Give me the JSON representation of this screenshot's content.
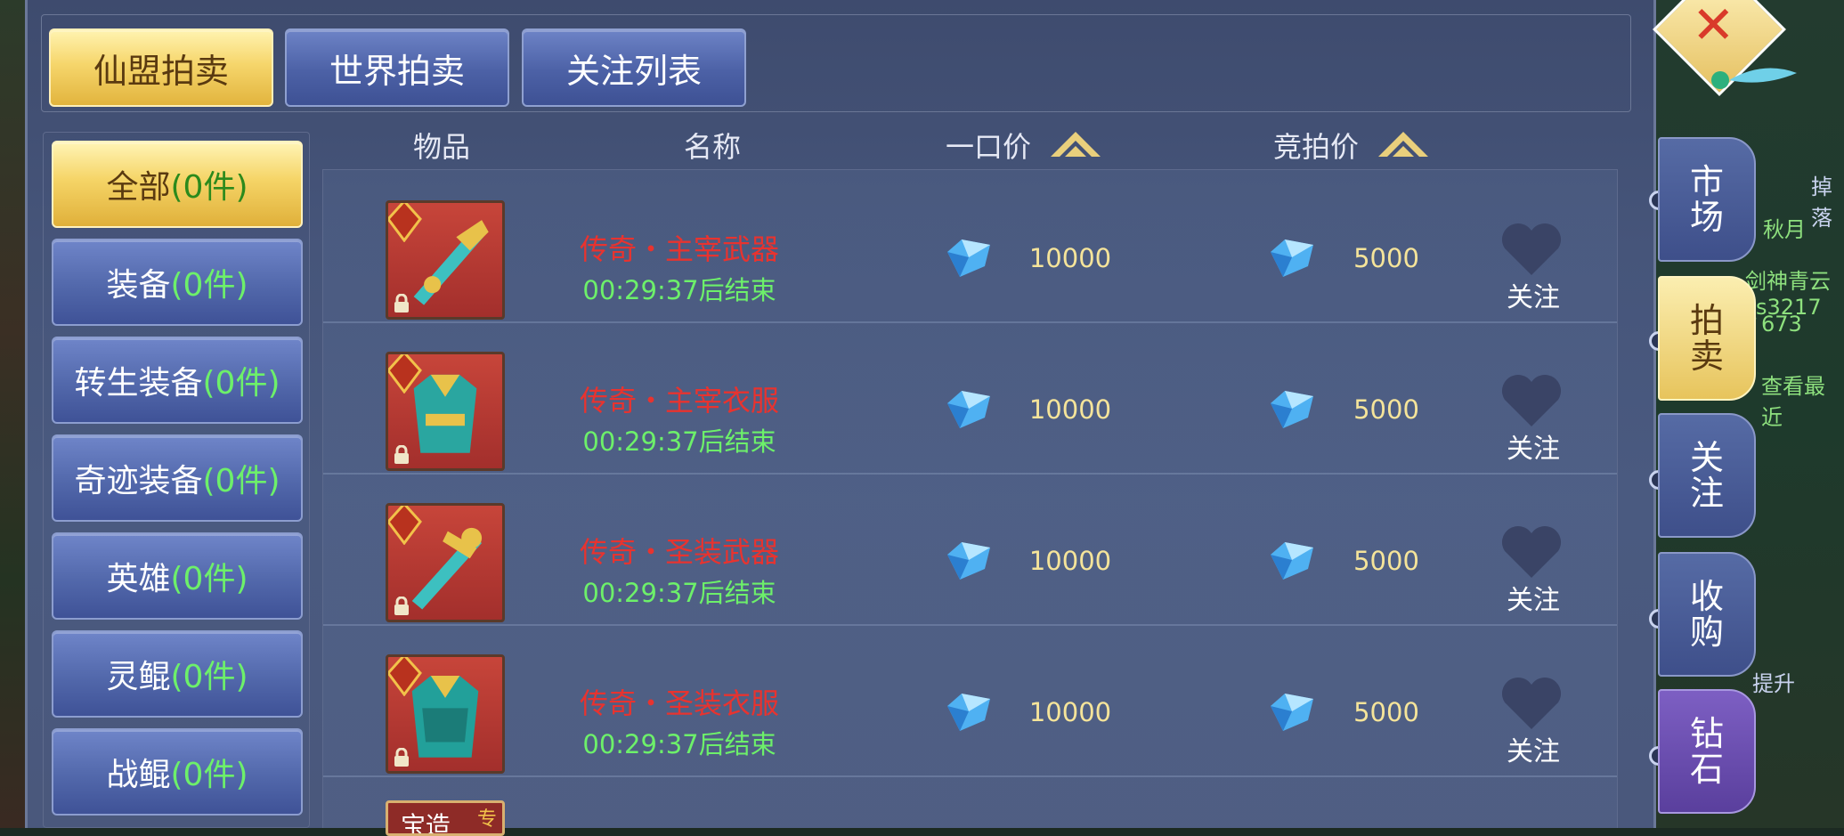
{
  "tabs": [
    {
      "label": "仙盟拍卖",
      "active": true
    },
    {
      "label": "世界拍卖",
      "active": false
    },
    {
      "label": "关注列表",
      "active": false
    }
  ],
  "categories": [
    {
      "name": "全部",
      "count": "(0件)",
      "active": true
    },
    {
      "name": "装备",
      "count": "(0件)",
      "active": false
    },
    {
      "name": "转生装备",
      "count": "(0件)",
      "active": false
    },
    {
      "name": "奇迹装备",
      "count": "(0件)",
      "active": false
    },
    {
      "name": "英雄",
      "count": "(0件)",
      "active": false
    },
    {
      "name": "灵鲲",
      "count": "(0件)",
      "active": false
    },
    {
      "name": "战鲲",
      "count": "(0件)",
      "active": false
    }
  ],
  "columns": {
    "item": "物品",
    "name": "名称",
    "buyout": "一口价",
    "bid": "竞拍价"
  },
  "rows": [
    {
      "name": "传奇・主宰武器",
      "time": "00:29:37后结束",
      "buyout": "10000",
      "bid": "5000",
      "follow": "关注",
      "badge": "传奇",
      "icon": "weapon-icon"
    },
    {
      "name": "传奇・主宰衣服",
      "time": "00:29:37后结束",
      "buyout": "10000",
      "bid": "5000",
      "follow": "关注",
      "badge": "传奇",
      "icon": "armor-icon"
    },
    {
      "name": "传奇・圣装武器",
      "time": "00:29:37后结束",
      "buyout": "10000",
      "bid": "5000",
      "follow": "关注",
      "badge": "传奇",
      "icon": "weapon-icon"
    },
    {
      "name": "传奇・圣装衣服",
      "time": "00:29:37后结束",
      "buyout": "10000",
      "bid": "5000",
      "follow": "关注",
      "badge": "传奇",
      "icon": "armor-icon"
    }
  ],
  "partial_row": {
    "name": "宝造",
    "badge": "专"
  },
  "side_tabs": [
    {
      "label": "市场",
      "active": false
    },
    {
      "label": "拍卖",
      "active": true
    },
    {
      "label": "关注",
      "active": false
    },
    {
      "label": "收购",
      "active": false
    },
    {
      "label": "钻石",
      "active": false
    }
  ],
  "side_bg_text": [
    "掉落",
    "秋月",
    "剑神青云_s3217",
    "673",
    "查看最近",
    "提升"
  ],
  "colors": {
    "item_name": "#e8332f",
    "time": "#6df06a",
    "price": "#f5e49a",
    "count": "#6df06a"
  }
}
